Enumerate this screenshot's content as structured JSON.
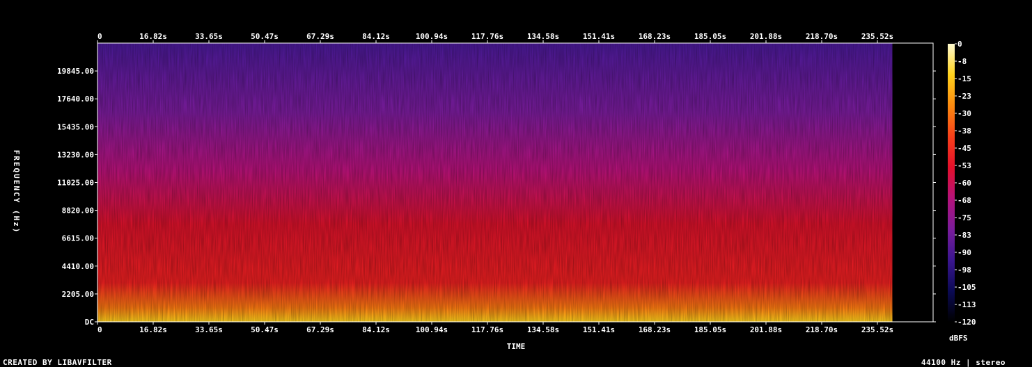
{
  "chart_data": {
    "type": "heatmap",
    "xlabel": "TIME",
    "ylabel": "FREQUENCY (Hz)",
    "colorbar_label": "dBFS",
    "time_ticks": [
      "0",
      "16.82s",
      "33.65s",
      "50.47s",
      "67.29s",
      "84.12s",
      "100.94s",
      "117.76s",
      "134.58s",
      "151.41s",
      "168.23s",
      "185.05s",
      "201.88s",
      "218.70s",
      "235.52s"
    ],
    "freq_ticks": [
      "DC",
      "2205.00",
      "4410.00",
      "6615.00",
      "8820.00",
      "11025.00",
      "13230.00",
      "15435.00",
      "17640.00",
      "19845.00"
    ],
    "db_ticks": [
      "0",
      "-8",
      "-15",
      "-23",
      "-30",
      "-38",
      "-45",
      "-53",
      "-60",
      "-68",
      "-75",
      "-83",
      "-90",
      "-98",
      "-105",
      "-113",
      "-120"
    ],
    "time_range_s": [
      0,
      252.3
    ],
    "audio_end_s": 240,
    "freq_range_hz": [
      0,
      22050
    ],
    "db_range": [
      -120,
      0
    ],
    "colormap": [
      "#000000",
      "#0b0a55",
      "#3b1690",
      "#7a1c9b",
      "#b5127a",
      "#e40f2a",
      "#f8401a",
      "#fc8a0f",
      "#ffd21c",
      "#fffbd0"
    ]
  },
  "footer": {
    "left": "CREATED BY LIBAVFILTER",
    "right": "44100 Hz | stereo"
  }
}
